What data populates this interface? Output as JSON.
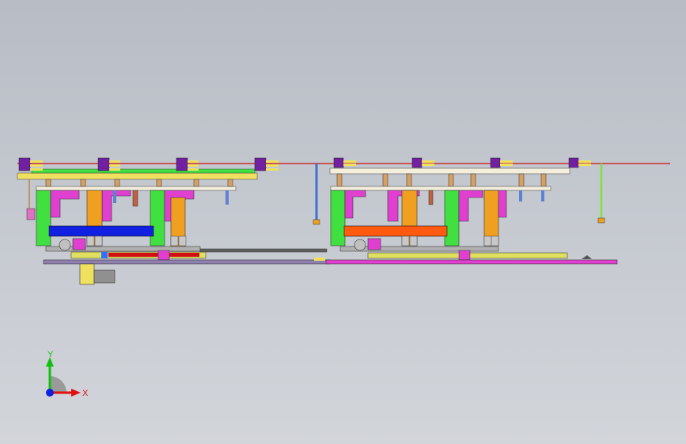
{
  "viewport": {
    "background_top": "#b8bcc4",
    "background_bottom": "#d2d5da"
  },
  "model": {
    "units": [
      "left-station",
      "right-station"
    ],
    "colors": {
      "frame_yellow": "#f0e060",
      "frame_green": "#40e040",
      "magenta": "#e040d0",
      "orange": "#f0a020",
      "purple": "#7020a0",
      "blue_bar": "#1020e0",
      "orange_bar": "#ff5a10",
      "red_line": "#d01010",
      "light_blue": "#60a0ff",
      "gray": "#888888",
      "cream": "#f4efdc"
    }
  },
  "triad": {
    "x_label": "X",
    "y_label": "Y",
    "x_color": "#e01010",
    "y_color": "#10c010",
    "z_color": "#1020e0"
  }
}
